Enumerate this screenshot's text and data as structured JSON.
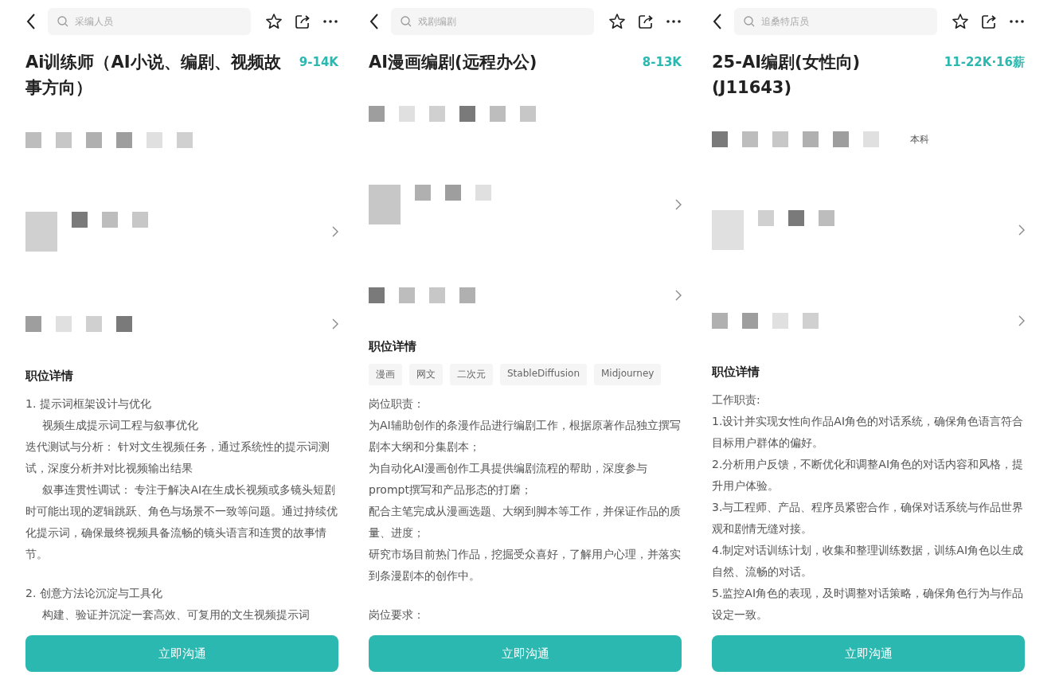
{
  "panels": [
    {
      "search": {
        "placeholder": "采编人员"
      },
      "title": "Ai训练师（AI小说、编剧、视频故事方向）",
      "salary": "9-14K",
      "blurred_rows": [
        {
          "has_chevron": false
        },
        {
          "has_chevron": true
        },
        {
          "has_chevron": true
        }
      ],
      "details": {
        "heading": "职位详情",
        "paragraphs": [
          {
            "text": "1. 提示词框架设计与优化",
            "indent": false,
            "gap_before": false
          },
          {
            "text": "视频生成提示词工程与叙事优化",
            "indent": true,
            "gap_before": false
          },
          {
            "text": "迭代测试与分析： 针对文生视频任务，通过系统性的提示词测试，深度分析并对比视频输出结果",
            "indent": false,
            "gap_before": false
          },
          {
            "text": "叙事连贯性调试： 专注于解决AI在生成长视频或多镜头短剧时可能出现的逻辑跳跃、角色与场景不一致等问题。通过持续优化提示词，确保最终视频具备流畅的镜头语言和连贯的故事情节。",
            "indent": true,
            "gap_before": false
          },
          {
            "text": "2. 创意方法论沉淀与工具化",
            "indent": false,
            "gap_before": true
          },
          {
            "text": "构建、验证并沉淀一套高效、可复用的文生视频提示词",
            "indent": true,
            "gap_before": false
          }
        ]
      },
      "button": "立即沟通"
    },
    {
      "search": {
        "placeholder": "戏剧编剧"
      },
      "title": "AI漫画编剧(远程办公)",
      "salary": "8-13K",
      "blurred_rows": [
        {
          "has_chevron": false
        },
        {
          "has_chevron": true
        },
        {
          "has_chevron": true
        }
      ],
      "details": {
        "heading": "职位详情",
        "tags": [
          "漫画",
          "网文",
          "二次元",
          "StableDiffusion",
          "Midjourney"
        ],
        "paragraphs": [
          {
            "text": "岗位职责：",
            "indent": false,
            "gap_before": false
          },
          {
            "text": "为AI辅助创作的条漫作品进行编剧工作，根据原著作品独立撰写剧本大纲和分集剧本；",
            "indent": false,
            "gap_before": false
          },
          {
            "text": "为自动化AI漫画创作工具提供编剧流程的帮助，深度参与prompt撰写和产品形态的打磨；",
            "indent": false,
            "gap_before": false
          },
          {
            "text": "配合主笔完成从漫画选题、大纲到脚本等工作，并保证作品的质量、进度；",
            "indent": false,
            "gap_before": false
          },
          {
            "text": "研究市场目前热门作品，挖掘受众喜好，了解用户心理，并落实到条漫剧本的创作中。",
            "indent": false,
            "gap_before": false
          },
          {
            "text": "岗位要求：",
            "indent": false,
            "gap_before": true
          }
        ]
      },
      "button": "立即沟通"
    },
    {
      "search": {
        "placeholder": "追桑特店员"
      },
      "title": "25-AI编剧(女性向)(J11643)",
      "salary": "11-22K·16薪",
      "blurred_rows": [
        {
          "has_chevron": false,
          "text": "本科"
        },
        {
          "has_chevron": true
        },
        {
          "has_chevron": true
        }
      ],
      "details": {
        "heading": "职位详情",
        "paragraphs": [
          {
            "text": "工作职责:",
            "indent": false,
            "gap_before": false
          },
          {
            "text": "1.设计并实现女性向作品AI角色的对话系统，确保角色语言符合目标用户群体的偏好。",
            "indent": false,
            "gap_before": false
          },
          {
            "text": "2.分析用户反馈，不断优化和调整AI角色的对话内容和风格，提升用户体验。",
            "indent": false,
            "gap_before": false
          },
          {
            "text": "3.与工程师、产品、程序员紧密合作，确保对话系统与作品世界观和剧情无缝对接。",
            "indent": false,
            "gap_before": false
          },
          {
            "text": "4.制定对话训练计划，收集和整理训练数据，训练AI角色以生成自然、流畅的对话。",
            "indent": false,
            "gap_before": false
          },
          {
            "text": "5.监控AI角色的表现，及时调整对话策略，确保角色行为与作品设定一致。",
            "indent": false,
            "gap_before": false
          }
        ]
      },
      "button": "立即沟通"
    }
  ]
}
